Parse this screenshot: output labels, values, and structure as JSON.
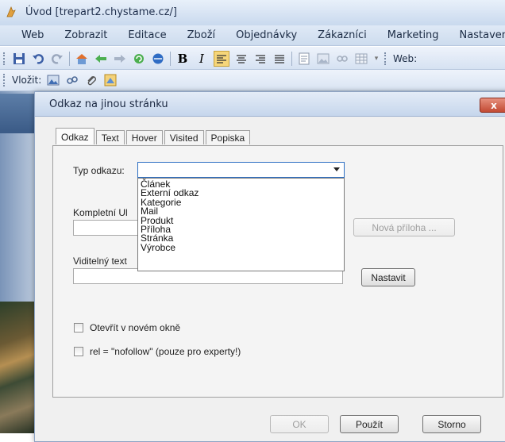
{
  "window": {
    "title": "Úvod [trepart2.chystame.cz/]"
  },
  "menu": [
    "Web",
    "Zobrazit",
    "Editace",
    "Zboží",
    "Objednávky",
    "Zákazníci",
    "Marketing",
    "Nastavení"
  ],
  "toolbar": {
    "web_label": "Web:"
  },
  "insert_bar": {
    "label": "Vložit:"
  },
  "dialog": {
    "title": "Odkaz na jinou stránku",
    "close_label": "x",
    "tabs": [
      "Odkaz",
      "Text",
      "Hover",
      "Visited",
      "Popiska"
    ],
    "active_tab": "Odkaz",
    "link_type": {
      "label": "Typ odkazu:",
      "value": "",
      "options": [
        "Článek",
        "Externí odkaz",
        "Kategorie",
        "Mail",
        "Produkt",
        "Příloha",
        "Stránka",
        "Výrobce"
      ]
    },
    "full_url": {
      "label": "Kompletní Ul",
      "value": ""
    },
    "new_attachment_label": "Nová příloha ...",
    "visible_text": {
      "label": "Viditelný text",
      "value": ""
    },
    "set_label": "Nastavit",
    "open_new_window": {
      "label": "Otevřít v novém okně",
      "checked": false
    },
    "nofollow": {
      "label": "rel = \"nofollow\" (pouze pro experty!)",
      "checked": false
    },
    "buttons": {
      "ok": "OK",
      "apply": "Použít",
      "cancel": "Storno"
    }
  }
}
